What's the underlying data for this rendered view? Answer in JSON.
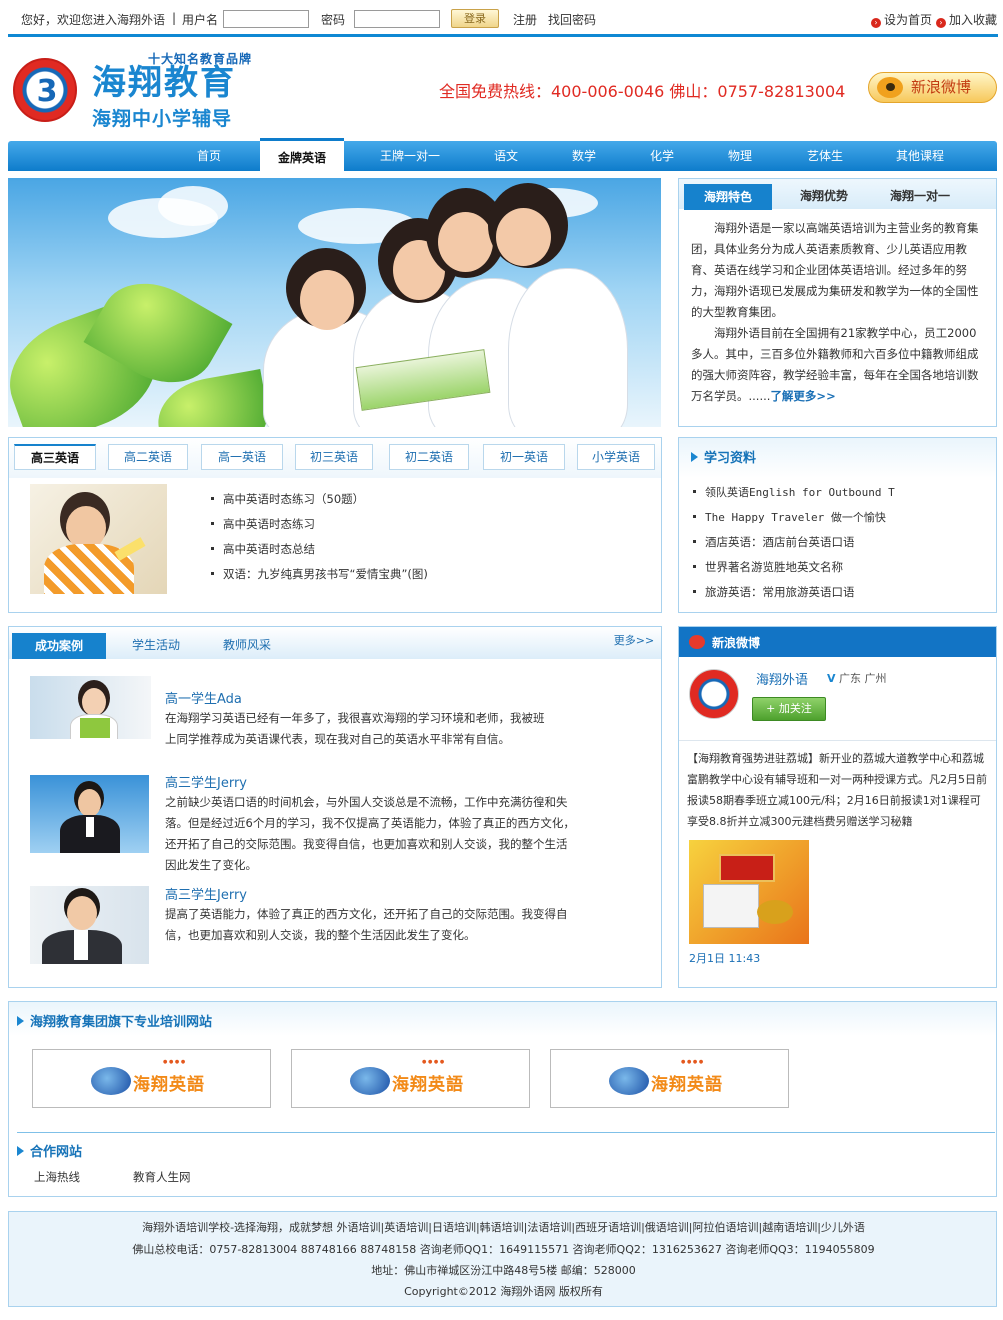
{
  "topbar": {
    "welcome": "您好，欢迎您进入海翔外语",
    "sep": "|",
    "username_label": "用户名",
    "password_label": "密码",
    "username_value": "",
    "password_value": "",
    "login_label": "登录",
    "register_label": "注册",
    "forgot_label": "找回密码",
    "set_home": "设为首页",
    "add_fav": "加入收藏"
  },
  "header": {
    "brand_tag": "十大知名教育品牌",
    "brand_name": "海翔教育",
    "brand_sub": "海翔中小学辅导",
    "hotline": "全国免费热线：400-006-0046 佛山：0757-82813004",
    "weibo_button": "新浪微博"
  },
  "nav": {
    "items": [
      "首页",
      "金牌英语",
      "王牌一对一",
      "语文",
      "数学",
      "化学",
      "物理",
      "艺体生",
      "其他课程"
    ],
    "active_index": 1
  },
  "feature": {
    "tabs": [
      "海翔特色",
      "海翔优势",
      "海翔一对一"
    ],
    "active_index": 0,
    "para1": "　　海翔外语是一家以高端英语培训为主营业务的教育集团，具体业务分为成人英语素质教育、少儿英语应用教育、英语在线学习和企业团体英语培训。经过多年的努力，海翔外语现已发展成为集研发和教学为一体的全国性的大型教育集团。",
    "para2": "　　海翔外语目前在全国拥有21家教学中心，员工2000多人。其中，三百多位外籍教师和六百多位中籍教师组成的强大师资阵容，教学经验丰富，每年在全国各地培训数万名学员。......",
    "more": "了解更多>>"
  },
  "grades": {
    "tabs": [
      "高三英语",
      "高二英语",
      "高一英语",
      "初三英语",
      "初二英语",
      "初一英语",
      "小学英语"
    ],
    "active_index": 0,
    "items": [
      "高中英语时态练习（50题）",
      "高中英语时态练习",
      "高中英语时态总结",
      "双语：九岁纯真男孩书写“爱情宝典”(图)"
    ]
  },
  "materials": {
    "title": "学习资料",
    "items": [
      "领队英语English for Outbound T",
      "The Happy Traveler 做一个愉快",
      "酒店英语：酒店前台英语口语",
      "世界著名游览胜地英文名称",
      "旅游英语：常用旅游英语口语"
    ]
  },
  "cases": {
    "tabs": [
      "成功案例",
      "学生活动",
      "教师风采"
    ],
    "active_index": 0,
    "more": "更多>>",
    "items": [
      {
        "title": "高一学生Ada",
        "body": "在海翔学习英语已经有一年多了，我很喜欢海翔的学习环境和老师，我被班上同学推荐成为英语课代表，现在我对自己的英语水平非常有自信。"
      },
      {
        "title": "高三学生Jerry",
        "body": "之前缺少英语口语的时间机会，与外国人交谈总是不流畅，工作中充满彷徨和失落。但是经过近6个月的学习，我不仅提高了英语能力，体验了真正的西方文化，还开拓了自己的交际范围。我变得自信，也更加喜欢和别人交谈，我的整个生活因此发生了变化。"
      },
      {
        "title": "高三学生Jerry",
        "body": "提高了英语能力，体验了真正的西方文化，还开拓了自己的交际范围。我变得自信，也更加喜欢和别人交谈，我的整个生活因此发生了变化。"
      }
    ]
  },
  "weibo": {
    "title": "新浪微博",
    "account": "海翔外语",
    "location": "广东 广州",
    "follow": "+ 加关注",
    "post": "【海翔教育强势进驻荔城】新开业的荔城大道教学中心和荔城富鹏教学中心设有辅导班和一对一两种授课方式。凡2月5日前报读58期春季班立减100元/科；2月16日前报读1对1课程可享受8.8折并立减300元建档费另赠送学习秘籍",
    "time": "2月1日 11:43"
  },
  "sites": {
    "title": "海翔教育集团旗下专业培训网站",
    "items": [
      "海翔英語",
      "海翔英語",
      "海翔英語"
    ]
  },
  "partners": {
    "title": "合作网站",
    "items": [
      "上海热线",
      "教育人生网"
    ]
  },
  "footer": {
    "line1": "海翔外语培训学校-选择海翔，成就梦想 外语培训|英语培训|日语培训|韩语培训|法语培训|西班牙语培训|俄语培训|阿拉伯语培训|越南语培训|少儿外语",
    "line2": "佛山总校电话：0757-82813004 88748166 88748158 咨询老师QQ1：1649115571 咨询老师QQ2：1316253627 咨询老师QQ3：1194055809",
    "line3": "地址：佛山市禅城区汾江中路48号5楼 邮编：528000",
    "line4": "Copyright©2012 海翔外语网 版权所有"
  }
}
